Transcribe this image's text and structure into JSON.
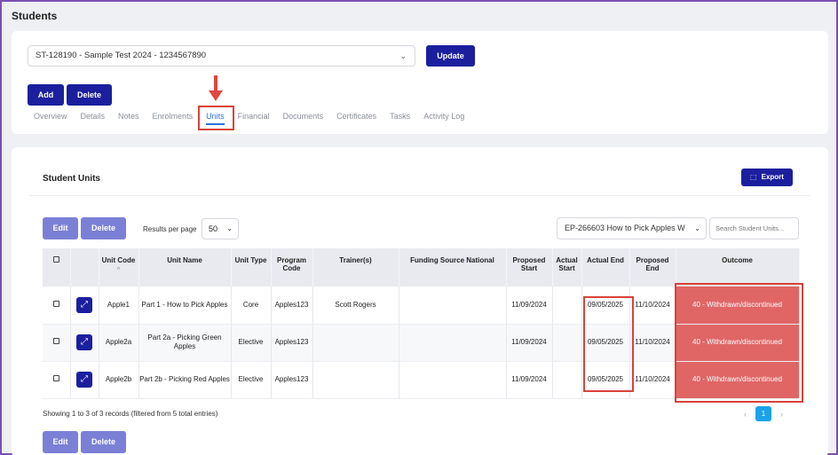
{
  "page": {
    "title": "Students"
  },
  "student_select": {
    "value": "ST-128190 - Sample Test 2024 - 1234567890"
  },
  "buttons": {
    "update": "Update",
    "add": "Add",
    "delete": "Delete",
    "export": "Export",
    "edit": "Edit"
  },
  "tabs": [
    "Overview",
    "Details",
    "Notes",
    "Enrolments",
    "Units",
    "Financial",
    "Documents",
    "Certificates",
    "Tasks",
    "Activity Log"
  ],
  "active_tab": "Units",
  "units_section": {
    "title": "Student Units",
    "results_per_page_label": "Results per page",
    "results_per_page": "50",
    "program_select": "EP-266603 How to Pick Apples W",
    "search_placeholder": "Search Student Units...",
    "columns": [
      "Unit Code",
      "Unit Name",
      "Unit Type",
      "Program Code",
      "Trainer(s)",
      "Funding Source National",
      "Proposed Start",
      "Actual Start",
      "Actual End",
      "Proposed End",
      "Outcome"
    ],
    "rows": [
      {
        "unit_code": "Apple1",
        "unit_name": "Part 1 - How to Pick Apples",
        "unit_type": "Core",
        "program_code": "Apples123",
        "trainer": "Scott Rogers",
        "funding": "",
        "proposed_start": "11/09/2024",
        "actual_start": "",
        "actual_end": "09/05/2025",
        "proposed_end": "11/10/2024",
        "outcome": "40 - Withdrawn/discontinued"
      },
      {
        "unit_code": "Apple2a",
        "unit_name": "Part 2a - Picking Green Apples",
        "unit_type": "Elective",
        "program_code": "Apples123",
        "trainer": "",
        "funding": "",
        "proposed_start": "11/09/2024",
        "actual_start": "",
        "actual_end": "09/05/2025",
        "proposed_end": "11/10/2024",
        "outcome": "40 - Withdrawn/discontinued"
      },
      {
        "unit_code": "Apple2b",
        "unit_name": "Part 2b - Picking Red Apples",
        "unit_type": "Elective",
        "program_code": "Apples123",
        "trainer": "",
        "funding": "",
        "proposed_start": "11/09/2024",
        "actual_start": "",
        "actual_end": "09/05/2025",
        "proposed_end": "11/10/2024",
        "outcome": "40 - Withdrawn/discontinued"
      }
    ],
    "showing_text": "Showing 1 to 3 of 3 records (filtered from 5 total entries)",
    "current_page": "1",
    "pager_prev": "‹",
    "pager_next": "›"
  },
  "icons": {
    "chevron": "⌄",
    "sort": "^",
    "expand": "⤢",
    "export": "⬚"
  },
  "colors": {
    "primary": "#1b1f9e",
    "secondary": "#7b80d6",
    "outcome": "#e06666",
    "highlight": "#d9423a",
    "active_tab": "#2a6fd8"
  }
}
